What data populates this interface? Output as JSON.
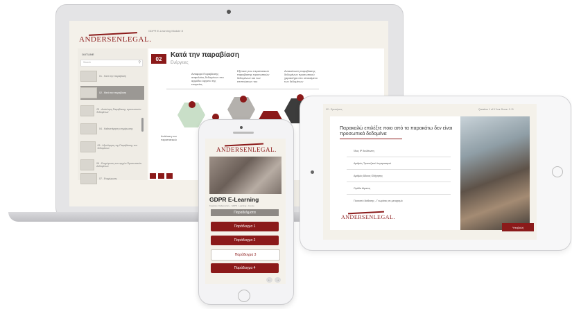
{
  "brand": {
    "logo": "ANDERSENLEGAL.",
    "color": "#8b1a1a"
  },
  "laptop": {
    "header_title": "GDPR E-Learning Module 8",
    "sidebar": {
      "heading": "OUTLINE",
      "search_placeholder": "Search",
      "items": [
        {
          "label": "01 - Κατά την παραβίαση"
        },
        {
          "label": "02 - Μετά την παραβίαση"
        },
        {
          "label": "03 - Ανάκληση Παραβίασης προσωπικών δεδομένων"
        },
        {
          "label": "04 - Καθυστέρηση ενημέρωσης"
        },
        {
          "label": "05 - Αξιολόγηση της Παραβίασης των δεδομένων"
        },
        {
          "label": "06 - Ενημέρωση των αρχών Προσωπικών Δεδομένων"
        },
        {
          "label": "07 - Ενημέρωση"
        }
      ]
    },
    "slide": {
      "number": "02",
      "title": "Κατά την παραβίαση",
      "subtitle": "Ενέργειες",
      "steps": [
        {
          "num": "01",
          "text": "Ανάλυση του περιστατικού"
        },
        {
          "num": "02",
          "text": "Αναφορά Παραβίασης ασφαλείας δεδομένων στο αρμόδιο όργανο της εταιρείας"
        },
        {
          "num": "03",
          "text": "Εξέταση του περιστατικού παραβίασης προσωπικών δεδομένων και των επιπτώσεων του"
        },
        {
          "num": "04",
          "text": "Ανακοίνωση παραβίασης δεδομένων προσωπικού χαρακτήρα στο υποκείμενο των δεδομένων"
        }
      ]
    }
  },
  "tablet": {
    "header_left": "02 - Ερωτήσεις",
    "header_right": "Question 1 of 5    Your Score: 0 / 5",
    "question": "Παρακαλώ επιλέξτε ποιο από τα παρακάτω δεν είναι προσωπικά δεδομένα",
    "options": [
      "Ίδιος IP διεύθυνση",
      "Αριθμός Τραπεζικού λογαριασμού",
      "Αριθμός Άδειας Οδήγησης",
      "Ομάδα Αίματος",
      "Ποσοστό διάθεσης - Γνωρίσεις σε μετοχισμό"
    ],
    "submit_label": "Υποβολή"
  },
  "phone": {
    "title": "GDPR E-Learning",
    "subtitle": "Κεφάλαιο: Κυβερνητική... GDPR - Learning - Course",
    "section_label": "Παραδείγματα",
    "buttons": [
      {
        "label": "Παράδειγμα 1",
        "style": "red"
      },
      {
        "label": "Παράδειγμα 2",
        "style": "red"
      },
      {
        "label": "Παράδειγμα 3",
        "style": "white"
      },
      {
        "label": "Παράδειγμα 4",
        "style": "red"
      }
    ]
  }
}
